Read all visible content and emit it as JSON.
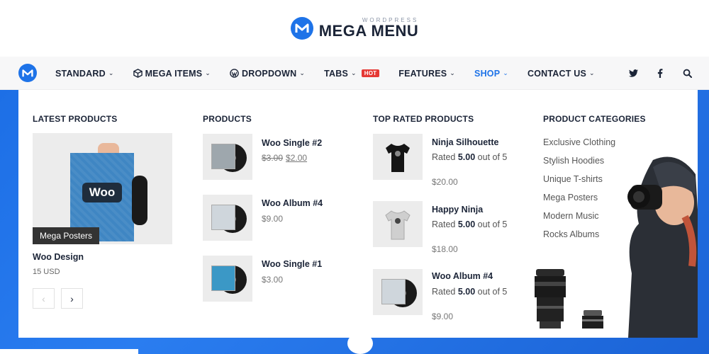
{
  "brand": {
    "small_text": "WORDPRESS",
    "big_text": "MEGA MENU",
    "accent": "#1e73e8"
  },
  "nav": {
    "items": [
      {
        "label": "STANDARD",
        "icon": "",
        "caret": "⌄"
      },
      {
        "label": "MEGA ITEMS",
        "icon": "cube-icon",
        "caret": "⌄"
      },
      {
        "label": "DROPDOWN",
        "icon": "wordpress-icon",
        "caret": "⌄"
      },
      {
        "label": "TABS",
        "icon": "",
        "caret": "⌄",
        "badge": "HOT"
      },
      {
        "label": "FEATURES",
        "icon": "",
        "caret": "⌄"
      },
      {
        "label": "SHOP",
        "icon": "",
        "caret": "⌄",
        "active": true
      },
      {
        "label": "CONTACT US",
        "icon": "",
        "caret": "⌄"
      }
    ],
    "right_icons": [
      "twitter-icon",
      "facebook-icon",
      "search-icon"
    ]
  },
  "mega": {
    "latest": {
      "title": "LATEST PRODUCTS",
      "image_tag": "Mega Posters",
      "poster_text": "Woo",
      "name": "Woo Design",
      "price": "15 USD",
      "prev_label": "‹",
      "next_label": "›"
    },
    "products": {
      "title": "PRODUCTS",
      "items": [
        {
          "name": "Woo Single #2",
          "old_price": "$3.00",
          "price": "$2.00"
        },
        {
          "name": "Woo Album #4",
          "price": "$9.00"
        },
        {
          "name": "Woo Single #1",
          "price": "$3.00"
        }
      ]
    },
    "top_rated": {
      "title": "TOP RATED PRODUCTS",
      "items": [
        {
          "name": "Ninja Silhouette",
          "rated_prefix": "Rated ",
          "rating": "5.00",
          "rated_suffix": " out of 5",
          "price": "$20.00"
        },
        {
          "name": "Happy Ninja",
          "rated_prefix": "Rated ",
          "rating": "5.00",
          "rated_suffix": " out of 5",
          "price": "$18.00"
        },
        {
          "name": "Woo Album #4",
          "rated_prefix": "Rated ",
          "rating": "5.00",
          "rated_suffix": " out of 5",
          "price": "$9.00"
        }
      ]
    },
    "categories": {
      "title": "PRODUCT CATEGORIES",
      "items": [
        "Exclusive Clothing",
        "Stylish Hoodies",
        "Unique T-shirts",
        "Mega Posters",
        "Modern Music",
        "Rocks Albums"
      ]
    }
  }
}
